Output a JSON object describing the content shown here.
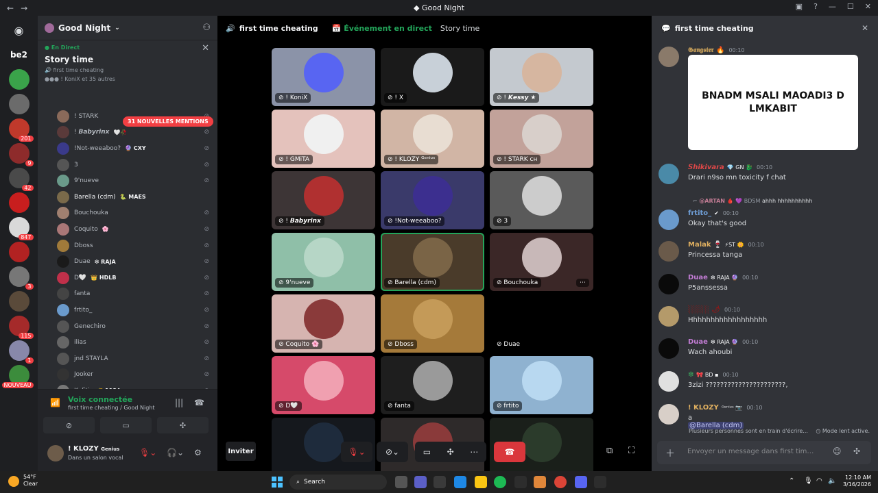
{
  "window": {
    "title": "Good Night",
    "nav_back": "←",
    "nav_forward": "→",
    "controls": [
      "▣",
      "?",
      "—",
      "☐",
      "✕"
    ]
  },
  "guilds": [
    {
      "label": "",
      "badge": "",
      "color": "#5865f2",
      "icon": "discord-logo-icon"
    },
    {
      "label": "be2",
      "badge": "",
      "color": "#1e1f22"
    },
    {
      "label": "",
      "badge": "",
      "color": "#3aa34a"
    },
    {
      "label": "",
      "badge": "",
      "color": "#6b6b6b"
    },
    {
      "label": "",
      "badge": "201",
      "color": "#c0392b"
    },
    {
      "label": "",
      "badge": "9",
      "color": "#8e2b2b"
    },
    {
      "label": "",
      "badge": "42",
      "color": "#4a4a4a"
    },
    {
      "label": "",
      "badge": "",
      "color": "#c81e1e"
    },
    {
      "label": "",
      "badge": "847",
      "color": "#d9d9d9"
    },
    {
      "label": "",
      "badge": "",
      "color": "#b22222"
    },
    {
      "label": "",
      "badge": "3",
      "color": "#777777"
    },
    {
      "label": "",
      "badge": "",
      "color": "#5a4a3a"
    },
    {
      "label": "",
      "badge": "115",
      "color": "#a52a2a"
    },
    {
      "label": "",
      "badge": "1",
      "color": "#8888aa"
    },
    {
      "label": "",
      "badge": "NOUVEAU",
      "color": "#3c8c3c"
    }
  ],
  "sidebar": {
    "server_name": "Good Night",
    "live": {
      "tag": "● En Direct",
      "title": "Story time",
      "channel": "first time cheating",
      "attendees": "! KoniX et 35 autres"
    },
    "mention_pill": "31 NOUVELLES MENTIONS",
    "members": [
      {
        "name": "! STARK",
        "tag": "",
        "muted": true,
        "color": "#8a6a5a",
        "bright": false
      },
      {
        "name": "! 𝘽𝙖𝙗𝙮𝙧𝙞𝙣𝙭",
        "tag": "🤍🥀",
        "muted": true,
        "color": "#5a3a3a",
        "bright": false
      },
      {
        "name": "!Not-weeaboo?",
        "tag": "🔮 CXY",
        "muted": true,
        "color": "#3a3a8a",
        "bright": false
      },
      {
        "name": "3",
        "tag": "",
        "muted": true,
        "color": "#555555",
        "bright": false
      },
      {
        "name": "9'nueve",
        "tag": "",
        "muted": true,
        "color": "#6a9a8a",
        "bright": false
      },
      {
        "name": "Barella (cdm)",
        "tag": "🐍 MAES",
        "muted": false,
        "color": "#7a6a4a",
        "bright": true
      },
      {
        "name": "Bouchouka",
        "tag": "",
        "muted": true,
        "color": "#a08070",
        "bright": false
      },
      {
        "name": "Coquito",
        "tag": "🌸",
        "muted": true,
        "color": "#aa7777",
        "bright": false
      },
      {
        "name": "Dboss",
        "tag": "",
        "muted": true,
        "color": "#a07a3a",
        "bright": false
      },
      {
        "name": "Duae",
        "tag": "❇ RAJA",
        "muted": true,
        "color": "#1a1a1a",
        "bright": false
      },
      {
        "name": "D🤍",
        "tag": "👑 HDLB",
        "muted": true,
        "color": "#c0304a",
        "bright": false
      },
      {
        "name": "fanta",
        "tag": "",
        "muted": true,
        "color": "#444444",
        "bright": false
      },
      {
        "name": "frtito_",
        "tag": "",
        "muted": true,
        "color": "#6a9acc",
        "bright": false
      },
      {
        "name": "Genechiro",
        "tag": "",
        "muted": true,
        "color": "#555555",
        "bright": false
      },
      {
        "name": "ilias",
        "tag": "",
        "muted": true,
        "color": "#666666",
        "bright": false
      },
      {
        "name": "jnd STAYLA",
        "tag": "",
        "muted": true,
        "color": "#555555",
        "bright": false
      },
      {
        "name": "Jooker",
        "tag": "",
        "muted": true,
        "color": "#333333",
        "bright": false
      },
      {
        "name": "Kofitir",
        "tag": "🌾 1984",
        "muted": true,
        "color": "#777777",
        "bright": false
      }
    ]
  },
  "voice": {
    "title": "Voix connectée",
    "subtitle": "first time cheating / Good Night"
  },
  "user": {
    "name": "! KLOZY",
    "badge": "Genius",
    "status": "Dans un salon vocal"
  },
  "stage": {
    "channel": "first time cheating",
    "live_label": "Événement en direct",
    "story": "Story time",
    "invite_label": "Inviter",
    "tiles": [
      {
        "label": "! KoniX",
        "bg": "#8b93a8",
        "av": "#5865f2",
        "speaking": false,
        "more": false
      },
      {
        "label": "! X",
        "bg": "#1a1a1a",
        "av": "#c8d0d8",
        "speaking": false,
        "more": false
      },
      {
        "label": "! 𝙆𝙚𝙨𝙨𝙮 ★",
        "bg": "#c4c9cf",
        "av": "#d6b6a0",
        "speaking": false,
        "more": false
      },
      {
        "label": "! GMiTA",
        "bg": "#e4c2bc",
        "av": "#f0f0f0",
        "speaking": false,
        "more": false
      },
      {
        "label": "! KLOZY ᴳᵉⁿⁱᵘˢ",
        "bg": "#d1b5a5",
        "av": "#e8ddd2",
        "speaking": false,
        "more": false
      },
      {
        "label": "! STARK ᴄʜ",
        "bg": "#c2a29a",
        "av": "#d8cfca",
        "speaking": false,
        "more": false
      },
      {
        "label": "! 𝘽𝙖𝙗𝙮𝙧𝙞𝙣𝙭",
        "bg": "#3d3536",
        "av": "#b03030",
        "speaking": false,
        "more": false
      },
      {
        "label": "!Not-weeaboo?",
        "bg": "#3a3a6a",
        "av": "#3c2f8f",
        "speaking": false,
        "more": false
      },
      {
        "label": "3",
        "bg": "#5a5a5a",
        "av": "#cccccc",
        "speaking": false,
        "more": false
      },
      {
        "label": "9'nueve",
        "bg": "#8fbfa8",
        "av": "#b6d6c6",
        "speaking": false,
        "more": false
      },
      {
        "label": "Barella (cdm)",
        "bg": "#4a3b2a",
        "av": "#7a6446",
        "speaking": true,
        "more": false
      },
      {
        "label": "Bouchouka",
        "bg": "#3b2727",
        "av": "#c8b8b8",
        "speaking": false,
        "more": true
      },
      {
        "label": "Coquito 🌸",
        "bg": "#d6b4b0",
        "av": "#8a3a3a",
        "speaking": false,
        "more": false
      },
      {
        "label": "Dboss",
        "bg": "#a57a3a",
        "av": "#c49a58",
        "speaking": false,
        "more": false
      },
      {
        "label": "Duae",
        "bg": "#000000",
        "av": "#000000",
        "speaking": false,
        "more": false
      },
      {
        "label": "D🤍",
        "bg": "#d64a6a",
        "av": "#f0a0b0",
        "speaking": false,
        "more": false
      },
      {
        "label": "fanta",
        "bg": "#1e1e1e",
        "av": "#9a9a9a",
        "speaking": false,
        "more": false
      },
      {
        "label": "frtito",
        "bg": "#8fb2d0",
        "av": "#b8d8f0",
        "speaking": false,
        "more": false
      },
      {
        "label": "",
        "bg": "#15181d",
        "av": "#1e2b3c",
        "speaking": false,
        "more": false
      },
      {
        "label": "",
        "bg": "#2e2a2a",
        "av": "#8a3a3a",
        "speaking": false,
        "more": false
      },
      {
        "label": "",
        "bg": "#1a1f1a",
        "av": "#2b3b2b",
        "speaking": false,
        "more": false
      }
    ]
  },
  "chat": {
    "title": "first time cheating",
    "image_text": "BNADM MSALI MAOADI3  D LMKABIT",
    "reply": {
      "name": "@ARTAN 🩸",
      "badge": "💜 BDSM",
      "text": "ahhh hhhhhhhhhh"
    },
    "messages": [
      {
        "name": "𝕲𝖆𝖓𝖌𝖘𝖙𝖊𝖗 🔥",
        "badge": "",
        "time": "00:10",
        "text": "",
        "color": "#c8a05a",
        "av": "#8a7a6a"
      },
      {
        "name": "𝙎𝙝𝙞𝙠𝙞𝙫𝙖𝙧𝙖",
        "badge": "💎 GN 🐉",
        "time": "00:10",
        "text": "Drari n9so mn toxicity f chat",
        "color": "#e04848",
        "av": "#4a8aa8"
      },
      {
        "name": "frtito_",
        "badge": "✔",
        "time": "00:10",
        "text": "Okay that's good",
        "color": "#6f9fd8",
        "av": "#6a9acc"
      },
      {
        "name": "Malak 🍷",
        "badge": "⚡ST 🌼",
        "time": "00:10",
        "text": "Princessa tanga",
        "color": "#e0b060",
        "av": "#6a5a4a"
      },
      {
        "name": "Duae",
        "badge": "❇ RAJA 🔮",
        "time": "00:10",
        "text": "P5anssessa",
        "color": "#c27cd4",
        "av": "#0a0a0a"
      },
      {
        "name": "░░░░ 🌶",
        "badge": "",
        "time": "00:10",
        "text": "Hhhhhhhhhhhhhhhhhh",
        "color": "#8a1a1a",
        "av": "#b49a6a"
      },
      {
        "name": "Duae",
        "badge": "❇ RAJA 🔮",
        "time": "00:10",
        "text": "Wach ahoubi",
        "color": "#c27cd4",
        "av": "#0a0a0a"
      },
      {
        "name": "❇",
        "badge": "🎀 BD ▪",
        "time": "00:10",
        "text": "3zizi ??????????????????????,",
        "color": "#3ba55c",
        "av": "#e0e0e0"
      },
      {
        "name": "! KLOZY",
        "badge": "ᴳᵉⁿⁱᵘˢ 📷",
        "time": "00:10",
        "text": "a",
        "color": "#e0b060",
        "av": "#d8cfc8",
        "mention": "@Barella (cdm)"
      }
    ],
    "typing": "Plusieurs personnes sont en train d'écrire...",
    "slow_mode": "Mode lent active.",
    "placeholder": "Envoyer un message dans first time ch..."
  },
  "taskbar": {
    "temp": "54°F",
    "weather": "Clear",
    "search": "Search",
    "time": "12:10 AM",
    "date": "3/16/2026"
  }
}
